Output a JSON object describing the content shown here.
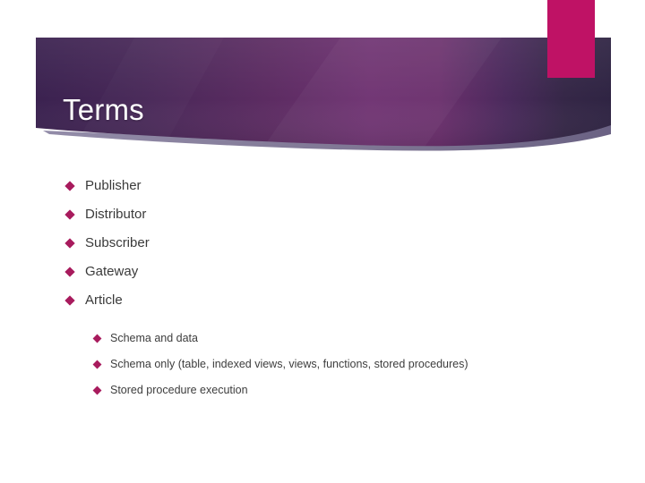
{
  "slide": {
    "title": "Terms",
    "theme": {
      "banner_gradient_start": "#3e2450",
      "banner_gradient_mid": "#6b2f6e",
      "banner_gradient_end": "#312647",
      "accent_pink": "#bf1265",
      "bullet_color": "#a81b5d",
      "wave_overlay": "#6f6589",
      "title_color": "#ffffff",
      "body_text_color": "#3a3a3a",
      "background": "#ffffff"
    },
    "decor": {
      "pink_tab_name": "accent-tab",
      "banner_name": "title-banner",
      "wave_name": "banner-wave"
    },
    "bullets": [
      {
        "level": 1,
        "text": "Publisher",
        "marker": "diamond-bullet-icon"
      },
      {
        "level": 1,
        "text": "Distributor",
        "marker": "diamond-bullet-icon"
      },
      {
        "level": 1,
        "text": "Subscriber",
        "marker": "diamond-bullet-icon"
      },
      {
        "level": 1,
        "text": "Gateway",
        "marker": "diamond-bullet-icon"
      },
      {
        "level": 1,
        "text": "Article",
        "marker": "diamond-bullet-icon"
      },
      {
        "level": 2,
        "text": "Schema and data",
        "marker": "diamond-bullet-icon"
      },
      {
        "level": 2,
        "text": "Schema only (table, indexed views, views, functions, stored procedures)",
        "marker": "diamond-bullet-icon"
      },
      {
        "level": 2,
        "text": "Stored procedure execution",
        "marker": "diamond-bullet-icon"
      }
    ]
  }
}
